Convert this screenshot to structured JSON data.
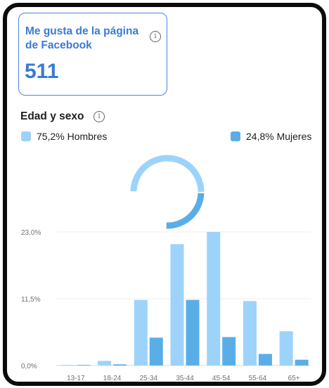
{
  "likes_card": {
    "title": "Me gusta de la página de Facebook",
    "value": "511",
    "info_icon": "info-icon"
  },
  "section": {
    "title": "Edad y sexo",
    "info_icon": "info-icon"
  },
  "legend": {
    "men_label": "75,2% Hombres",
    "women_label": "24,8% Mujeres"
  },
  "colors": {
    "accent": "#3b7ad6",
    "men": "#9dd3fa",
    "women": "#5aaee8"
  },
  "chart_data": [
    {
      "type": "pie",
      "categories": [
        "Hombres",
        "Mujeres"
      ],
      "values": [
        75.2,
        24.8
      ],
      "title": "",
      "donut": true
    },
    {
      "type": "bar",
      "categories": [
        "13-17",
        "18-24",
        "25-34",
        "35-44",
        "45-54",
        "55-64",
        "65+"
      ],
      "series": [
        {
          "name": "Hombres",
          "values": [
            0.1,
            0.8,
            11.3,
            20.9,
            23.0,
            11.1,
            5.9
          ]
        },
        {
          "name": "Mujeres",
          "values": [
            0.1,
            0.2,
            4.8,
            11.3,
            4.9,
            2.0,
            1.0
          ]
        }
      ],
      "ytick_labels": [
        "0,0%",
        "11,5%",
        "23,0%"
      ],
      "yticks": [
        0,
        11.5,
        23.0
      ],
      "ylim": [
        0,
        23.0
      ],
      "grid": true,
      "xlabel": "",
      "ylabel": ""
    }
  ]
}
